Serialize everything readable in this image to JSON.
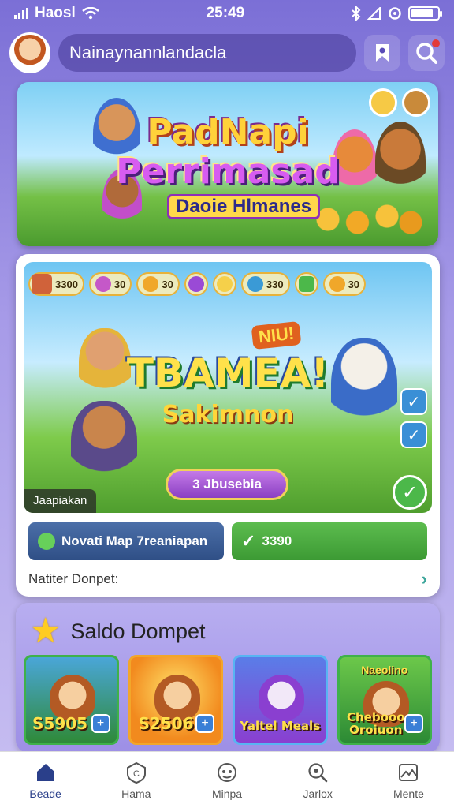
{
  "status_bar": {
    "carrier": "Haosl",
    "time": "25:49"
  },
  "header": {
    "username": "Nainaynannlandacla"
  },
  "banner": {
    "title1": "PadNapi",
    "title2": "Perrimasad",
    "subtitle": "Daoie Hlmanes"
  },
  "game_card": {
    "resources": [
      {
        "label": "3300"
      },
      {
        "label": "30"
      },
      {
        "label": "30"
      },
      {
        "label": ""
      },
      {
        "label": ""
      },
      {
        "label": "330"
      },
      {
        "label": ""
      },
      {
        "label": "30"
      }
    ],
    "badge": "NIU!",
    "title": "TBAMEA!",
    "subtitle": "Sakimnon",
    "play_button": "3 Jbusebia",
    "scene_label": "Jaapiakan",
    "action_left": "Novati Map 7reaniapan",
    "action_right": "3390",
    "wallet_link": "Natiter Donpet:"
  },
  "saldo": {
    "title": "Saldo Dompet",
    "tiles": [
      {
        "top": "",
        "label": "S5905"
      },
      {
        "top": "",
        "label": "S2506"
      },
      {
        "top": "",
        "label": "Yaltel Meals"
      },
      {
        "top": "Naeolino",
        "label": "Chebooo Oroiuon"
      }
    ]
  },
  "nav": [
    {
      "label": "Beade"
    },
    {
      "label": "Hama"
    },
    {
      "label": "Minpa"
    },
    {
      "label": "Jarlox"
    },
    {
      "label": "Mente"
    }
  ],
  "colors": {
    "primary": "#7b6fd6",
    "accent_green": "#4cb84a",
    "accent_yellow": "#ffcc22"
  },
  "icons": [
    "signal-icon",
    "wifi-icon",
    "bluetooth-icon",
    "battery-icon",
    "bookmark-icon",
    "search-icon",
    "star-icon",
    "home-icon",
    "check-icon",
    "chevron-right-icon"
  ]
}
